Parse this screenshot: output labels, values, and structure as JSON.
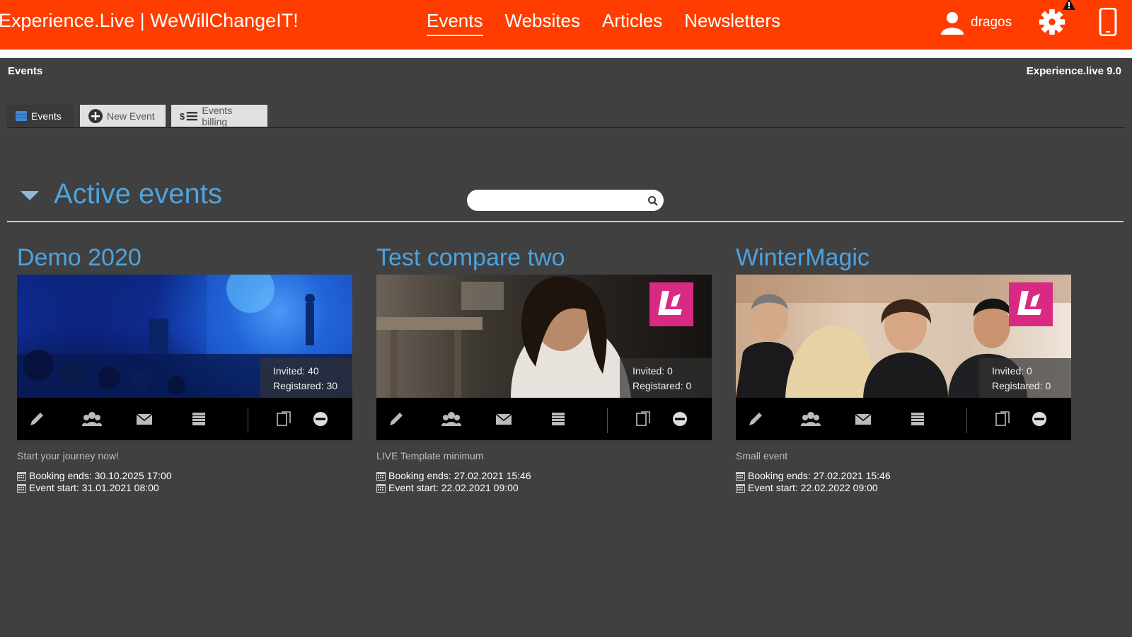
{
  "app": {
    "brand": "Experience.Live | WeWillChangeIT!",
    "nav": [
      {
        "label": "Events",
        "active": true
      },
      {
        "label": "Websites",
        "active": false
      },
      {
        "label": "Articles",
        "active": false
      },
      {
        "label": "Newsletters",
        "active": false
      }
    ],
    "user": {
      "name": "dragos"
    },
    "accent_color": "#ff3d00"
  },
  "header": {
    "breadcrumb": "Events",
    "version": "Experience.live 9.0"
  },
  "tabs": [
    {
      "label": "Events",
      "icon": "list-icon",
      "active": true
    },
    {
      "label": "New Event",
      "icon": "plus-circle-icon",
      "active": false
    },
    {
      "label": "Events billing",
      "icon": "billing-list-icon",
      "active": false
    }
  ],
  "section": {
    "title": "Active events",
    "search": {
      "value": "",
      "placeholder": ""
    }
  },
  "events": [
    {
      "title": "Demo 2020",
      "invited": "Invited: 40",
      "registered": "Registared: 30",
      "description": "Start your journey now!",
      "booking_ends": "Booking ends: 30.10.2025 17:00",
      "event_start": "Event start: 31.01.2021 08:00"
    },
    {
      "title": "Test compare two",
      "invited": "Invited: 0",
      "registered": "Registared: 0",
      "description": "LIVE Template minimum",
      "booking_ends": "Booking ends: 27.02.2021 15:46",
      "event_start": "Event start: 22.02.2021 09:00"
    },
    {
      "title": "WinterMagic",
      "invited": "Invited: 0",
      "registered": "Registared: 0",
      "description": "Small event",
      "booking_ends": "Booking ends: 27.02.2021 15:46",
      "event_start": "Event start: 22.02.2022 09:00"
    }
  ],
  "card_tools": [
    "edit-icon",
    "attendees-icon",
    "mail-icon",
    "list-icon",
    "copy-icon",
    "remove-icon"
  ]
}
